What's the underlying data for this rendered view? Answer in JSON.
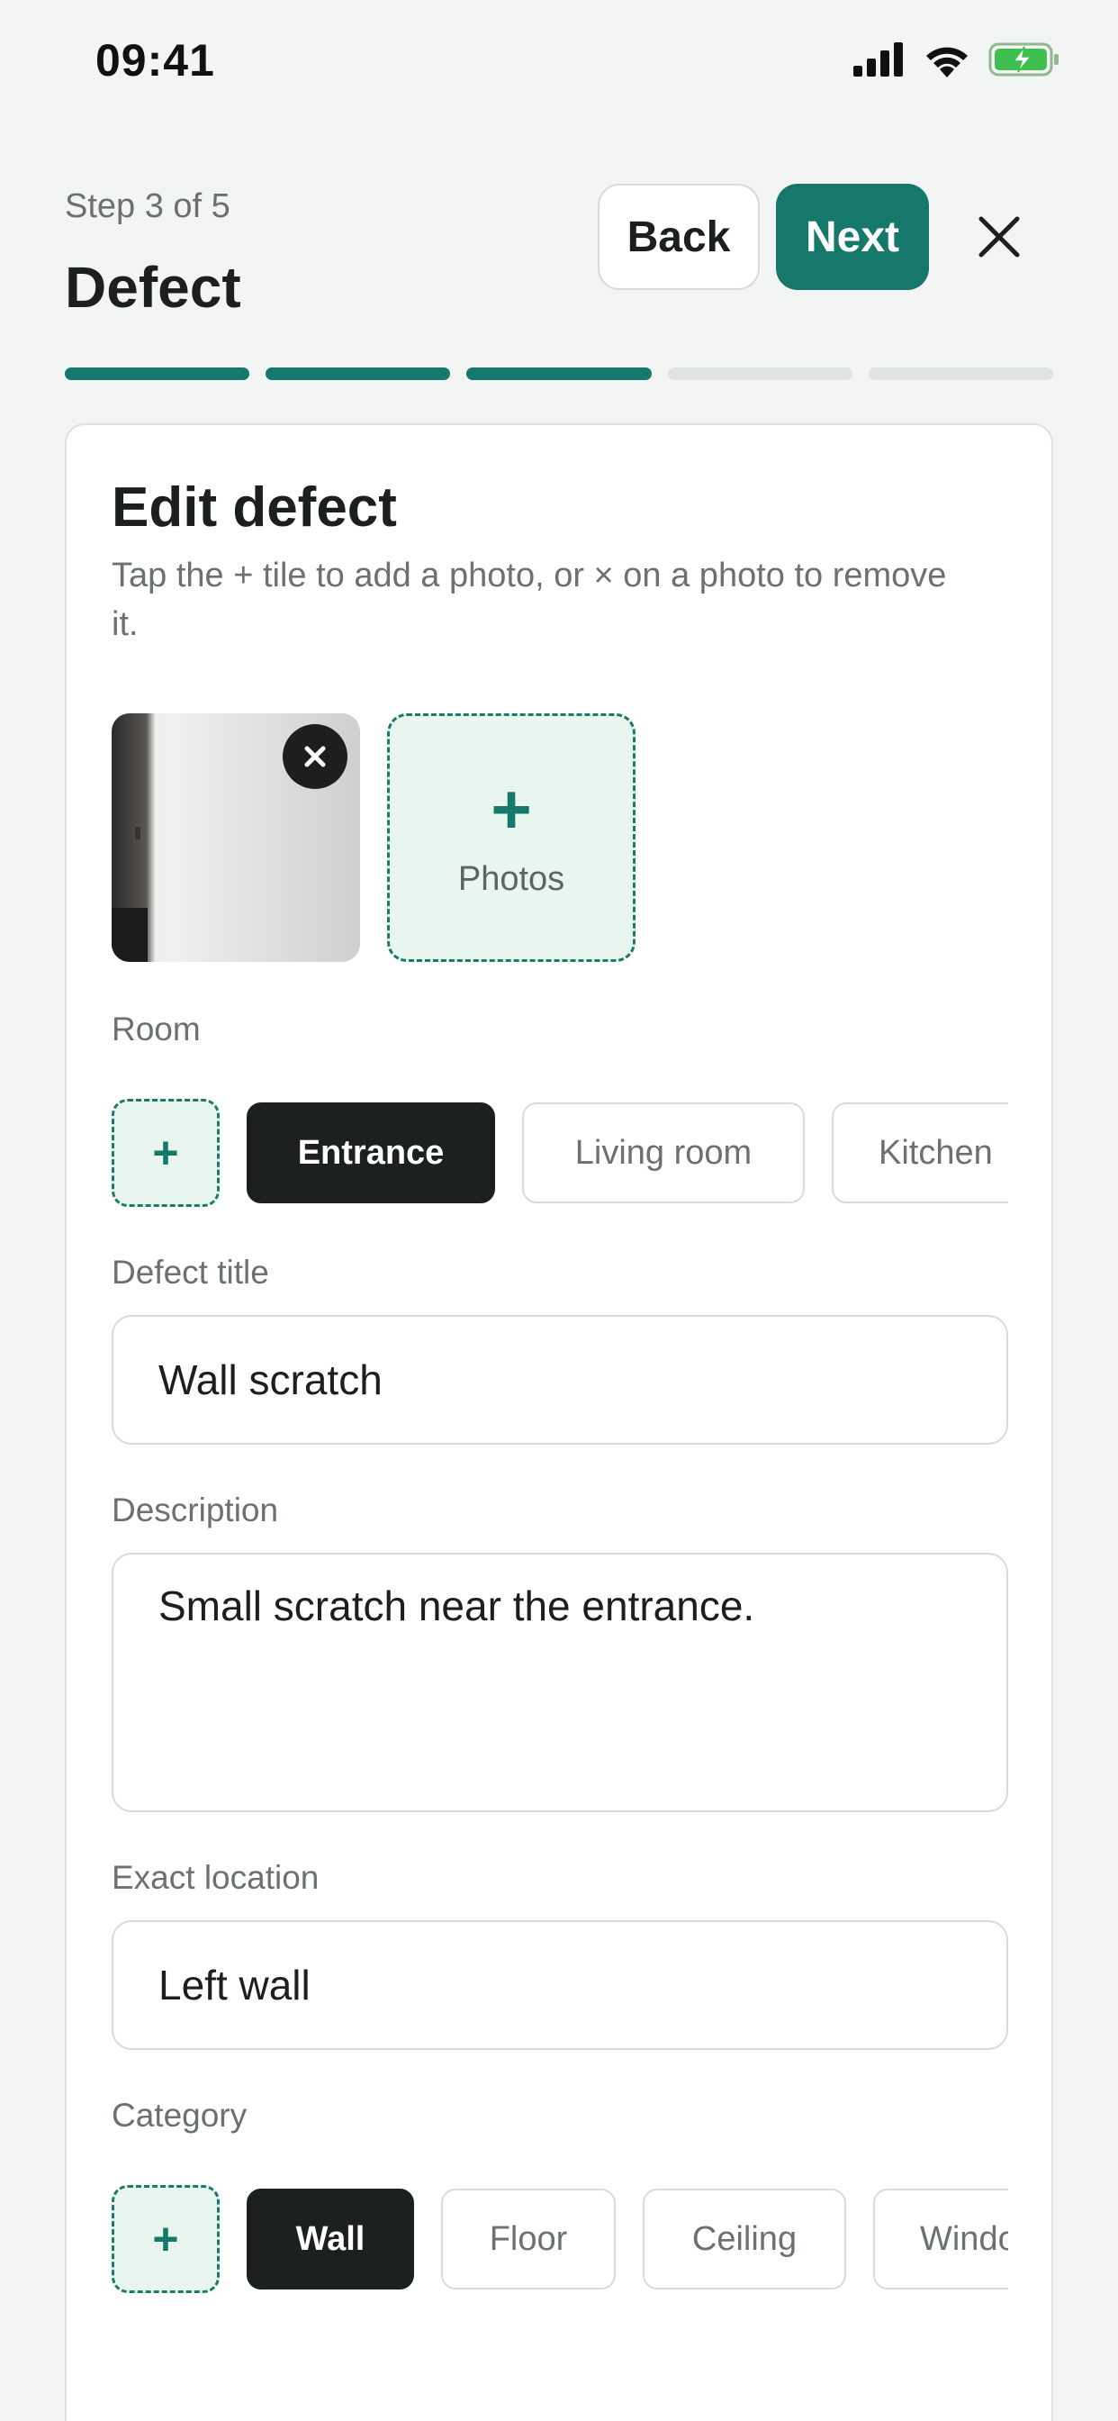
{
  "status_bar": {
    "time": "09:41"
  },
  "header": {
    "step": "Step 3 of 5",
    "title": "Defect",
    "back_label": "Back",
    "next_label": "Next",
    "accent_color": "#16786a"
  },
  "progress": {
    "total_steps": 5,
    "completed_steps": 3
  },
  "card": {
    "title": "Edit defect",
    "subtitle": "Tap the + tile to add a photo, or × on a photo to remove it.",
    "add_photo_label": "Photos",
    "room": {
      "label": "Room",
      "add_symbol": "+",
      "options": [
        "Entrance",
        "Living room",
        "Kitchen"
      ],
      "selected": "Entrance"
    },
    "defect_title": {
      "label": "Defect title",
      "value": "Wall scratch"
    },
    "description": {
      "label": "Description",
      "value": "Small scratch near the entrance."
    },
    "exact_location": {
      "label": "Exact location",
      "value": "Left wall"
    },
    "category": {
      "label": "Category",
      "add_symbol": "+",
      "options": [
        "Wall",
        "Floor",
        "Ceiling",
        "Window"
      ],
      "selected": "Wall"
    }
  }
}
